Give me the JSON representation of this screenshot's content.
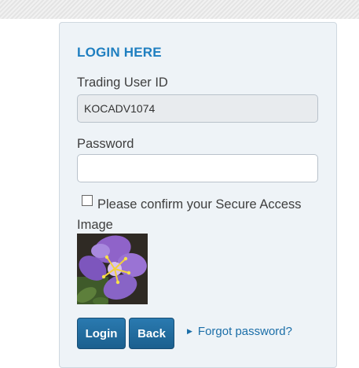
{
  "login": {
    "title": "LOGIN HERE",
    "user_id_label": "Trading User ID",
    "user_id_value": "KOCADV1074",
    "password_label": "Password",
    "password_value": "",
    "confirm_label": "Please confirm your Secure Access Image",
    "confirm_checked": false,
    "secure_image_icon": "purple-flower-image",
    "login_button": "Login",
    "back_button": "Back",
    "forgot_link": "Forgot password?",
    "accent_color": "#1f7fc0",
    "button_color": "#1b5f8e"
  }
}
